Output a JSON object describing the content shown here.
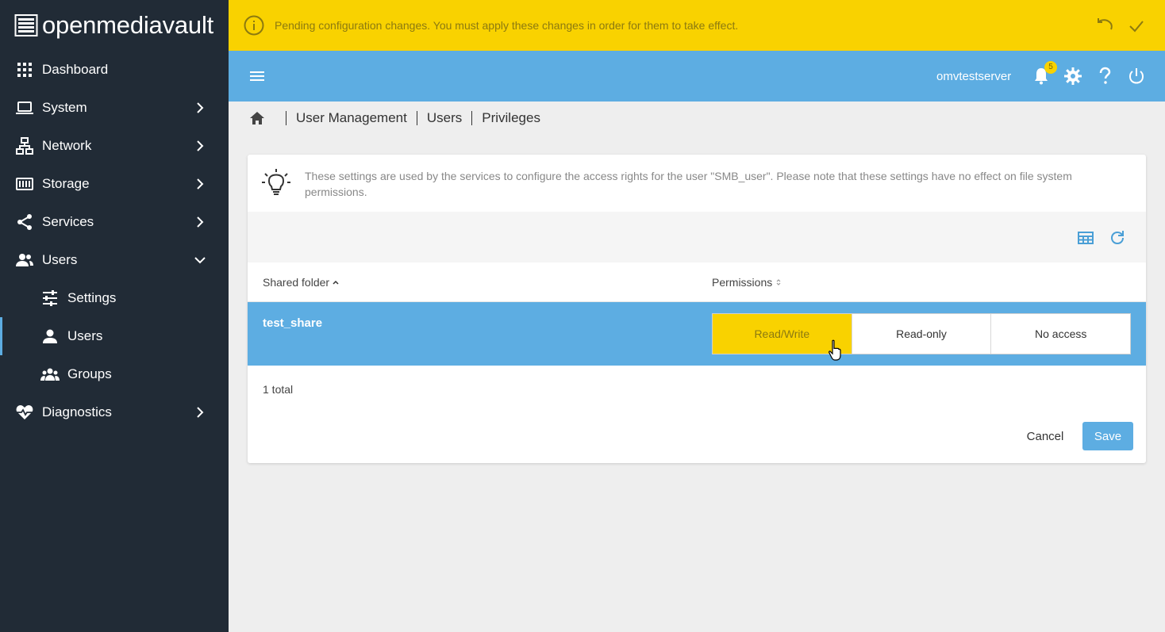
{
  "app": {
    "logo_text": "openmediavault"
  },
  "sidebar": {
    "items": [
      {
        "label": "Dashboard",
        "icon": "grid-icon"
      },
      {
        "label": "System",
        "icon": "laptop-icon"
      },
      {
        "label": "Network",
        "icon": "network-icon"
      },
      {
        "label": "Storage",
        "icon": "storage-icon"
      },
      {
        "label": "Services",
        "icon": "share-icon"
      },
      {
        "label": "Users",
        "icon": "users-icon",
        "expanded": true
      },
      {
        "label": "Settings",
        "icon": "tune-icon"
      },
      {
        "label": "Users",
        "icon": "user-icon",
        "active": true
      },
      {
        "label": "Groups",
        "icon": "groups-icon"
      },
      {
        "label": "Diagnostics",
        "icon": "heart-pulse-icon"
      }
    ]
  },
  "banner": {
    "message": "Pending configuration changes. You must apply these changes in order for them to take effect.",
    "color": "#f9d200"
  },
  "topbar": {
    "hostname": "omvtestserver",
    "notification_count": "5",
    "color": "#5dade2"
  },
  "breadcrumb": {
    "items": [
      "User Management",
      "Users",
      "Privileges"
    ]
  },
  "hint": {
    "text": "These settings are used by the services to configure the access rights for the user \"SMB_user\". Please note that these settings have no effect on file system permissions."
  },
  "table": {
    "columns": [
      "Shared folder",
      "Permissions"
    ],
    "rows": [
      {
        "shared_folder": "test_share",
        "permission_options": [
          "Read/Write",
          "Read-only",
          "No access"
        ],
        "selected": "Read/Write"
      }
    ],
    "total": "1 total"
  },
  "actions": {
    "cancel": "Cancel",
    "save": "Save"
  }
}
